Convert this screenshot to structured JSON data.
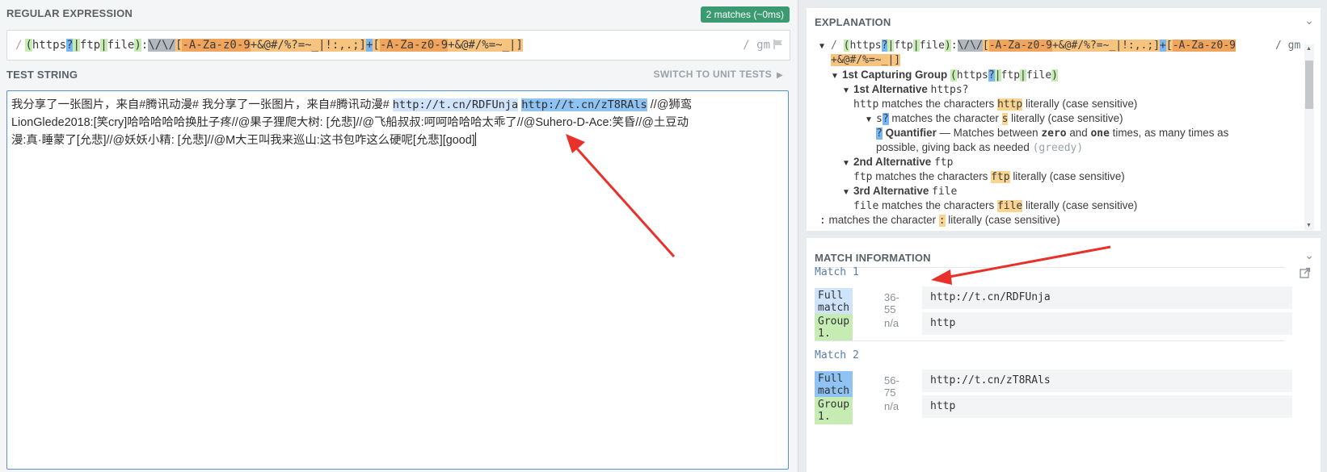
{
  "regex_section": {
    "label": "REGULAR EXPRESSION",
    "badge": "2 matches (~0ms)",
    "open_delim": "/",
    "flags": "/ gm",
    "tokens": {
      "g_open": "(",
      "t_https": "https",
      "t_q": "?",
      "t_pipe1": "|",
      "t_ftp": "ftp",
      "t_pipe2": "|",
      "t_file": "file",
      "g_close": ")",
      "t_colon": ":",
      "t_esc": "\\/\\/",
      "c1_open": "[",
      "c1_r1": "-A-Za-z0-9",
      "c1_rest": "+&@#/%?=~_|!:,.;",
      "c1_close": "]",
      "t_plus": "+",
      "c2_open": "[",
      "c2_r1": "-A-Za-z0-9",
      "c2_rest": "+&@#/%=~_|",
      "c2_close": "]"
    }
  },
  "test_section": {
    "label": "TEST STRING",
    "switch_label": "SWITCH TO UNIT TESTS",
    "text_before": "我分享了一张图片，来自#腾讯动漫# 我分享了一张图片，来自#腾讯动漫# ",
    "match1": "http://t.cn/RDFUnja",
    "between": " ",
    "match2": "http://t.cn/zT8RAls",
    "text_after1": " //@狮鸾",
    "line2": "LionGlede2018:[笑cry]哈哈哈哈哈换肚子疼//@果子狸爬大树: [允悲]//@飞船叔叔:呵呵哈哈哈太乖了//@Suhero-D-Ace:笑昏//@土豆动",
    "line3": "漫:真·睡蒙了[允悲]//@妖妖小精: [允悲]//@M大王叫我来巡山:这书包咋这么硬呢[允悲][good]"
  },
  "explanation": {
    "label": "EXPLANATION",
    "l1_delim": "/",
    "l1_flags": "/ gm",
    "l2_head": "1st Capturing Group",
    "l3_head": "1st Alternative",
    "l3_code": "https?",
    "l4_code": "http",
    "l4_text1": " matches the characters ",
    "l4_hl": "http",
    "l4_text2": " literally (case sensitive)",
    "l5_code": "s",
    "l5_q": "?",
    "l5_text1": " matches the character ",
    "l5_hl": "s",
    "l5_text2": " literally (case sensitive)",
    "l6_q": "?",
    "l6_head": "Quantifier",
    "l6_text1": " — Matches between ",
    "l6_zero": "zero",
    "l6_and": " and ",
    "l6_one": "one",
    "l6_text2": " times, as many times as",
    "l7_text": "possible, giving back as needed ",
    "l7_greedy": "(greedy)",
    "l8_head": "2nd Alternative",
    "l8_code": "ftp",
    "l9_code": "ftp",
    "l9_text1": " matches the characters ",
    "l9_hl": "ftp",
    "l9_text2": " literally (case sensitive)",
    "l10_head": "3rd Alternative",
    "l10_code": "file",
    "l11_code": "file",
    "l11_text1": " matches the characters ",
    "l11_hl": "file",
    "l11_text2": " literally (case sensitive)",
    "l12_code": ":",
    "l12_text1": " matches the character ",
    "l12_hl": ":",
    "l12_text2": " literally (case sensitive)"
  },
  "match_info": {
    "label": "MATCH INFORMATION",
    "matches": [
      {
        "title": "Match 1",
        "full_label": "Full match",
        "range": "36-55",
        "value": "http://t.cn/RDFUnja",
        "group_label": "Group 1.",
        "group_range": "n/a",
        "group_value": "http"
      },
      {
        "title": "Match 2",
        "full_label": "Full match",
        "range": "56-75",
        "value": "http://t.cn/zT8RAls",
        "group_label": "Group 1.",
        "group_range": "n/a",
        "group_value": "http"
      }
    ]
  },
  "colors": {
    "accent": "#3b9a6f",
    "match_light": "#cfe3fb",
    "match_dark": "#8fc3f3",
    "arrow": "#e8312a"
  }
}
